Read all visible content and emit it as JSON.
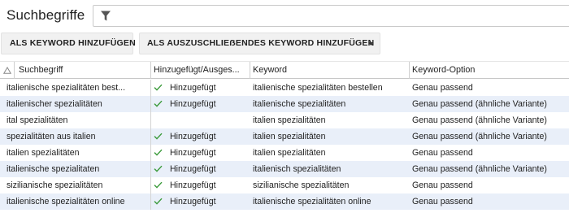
{
  "header": {
    "title": "Suchbegriffe"
  },
  "filter": {
    "icon": "filter-icon"
  },
  "toolbar": {
    "add_keyword_label": "ALS KEYWORD HINZUFÜGEN",
    "add_negative_label": "ALS AUSZUSCHLIEẞENDES KEYWORD HINZUFÜGEN"
  },
  "table": {
    "columns": [
      "Suchbegriff",
      "Hinzugefügt/Ausges...",
      "Keyword",
      "Keyword-Option"
    ],
    "rows": [
      {
        "term": "italienische spezialitäten best...",
        "status": "Hinzugefügt",
        "keyword": "italienische spezialitäten bestellen",
        "option": "Genau passend"
      },
      {
        "term": "italienischer spezialitäten",
        "status": "Hinzugefügt",
        "keyword": "italienische spezialitäten",
        "option": "Genau passend (ähnliche Variante)"
      },
      {
        "term": "ital spezialitäten",
        "status": "",
        "keyword": "italien spezialitäten",
        "option": "Genau passend (ähnliche Variante)"
      },
      {
        "term": "spezialitäten aus italien",
        "status": "Hinzugefügt",
        "keyword": "italien spezialitäten",
        "option": "Genau passend (ähnliche Variante)"
      },
      {
        "term": "italien spezialitäten",
        "status": "Hinzugefügt",
        "keyword": "italien spezialitäten",
        "option": "Genau passend"
      },
      {
        "term": "italienische spezialitaten",
        "status": "Hinzugefügt",
        "keyword": "italienisch spezialitäten",
        "option": "Genau passend (ähnliche Variante)"
      },
      {
        "term": "sizilianische spezialitäten",
        "status": "Hinzugefügt",
        "keyword": "sizilianische spezialitäten",
        "option": "Genau passend"
      },
      {
        "term": "italienische spezialitäten online",
        "status": "Hinzugefügt",
        "keyword": "italienische spezialitäten online",
        "option": "Genau passend"
      }
    ]
  },
  "colors": {
    "row_alt": "#e9eff9",
    "check": "#3a9a3a"
  }
}
